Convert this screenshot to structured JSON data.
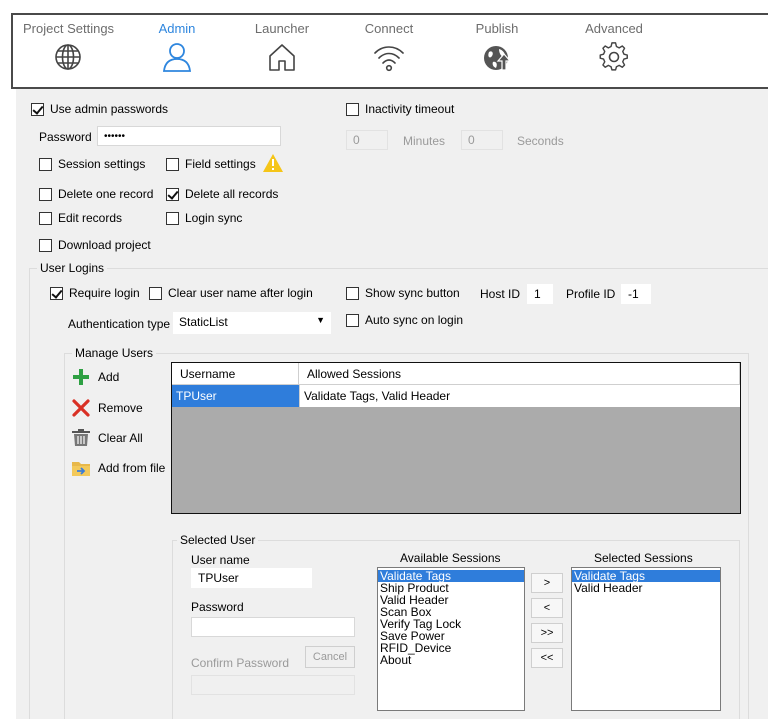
{
  "tabs": [
    {
      "label": "Project Settings",
      "icon": "globe-icon",
      "active": false
    },
    {
      "label": "Admin",
      "icon": "user-icon",
      "active": true
    },
    {
      "label": "Launcher",
      "icon": "home-icon",
      "active": false
    },
    {
      "label": "Connect",
      "icon": "wifi-icon",
      "active": false
    },
    {
      "label": "Publish",
      "icon": "publish-globe-icon",
      "active": false
    },
    {
      "label": "Advanced",
      "icon": "gear-icon",
      "active": false
    }
  ],
  "admin": {
    "use_admin_passwords": "Use admin passwords",
    "password_label": "Password",
    "password_value": "••••••",
    "session_settings": "Session settings",
    "field_settings": "Field settings",
    "delete_one_record": "Delete one record",
    "delete_all_records": "Delete all records",
    "edit_records": "Edit records",
    "login_sync": "Login sync",
    "download_project": "Download project"
  },
  "inactivity": {
    "label": "Inactivity timeout",
    "minutes_value": "0",
    "minutes_label": "Minutes",
    "seconds_value": "0",
    "seconds_label": "Seconds"
  },
  "user_logins": {
    "group_label": "User Logins",
    "require_login": "Require login",
    "clear_user_name": "Clear user name after login",
    "show_sync_button": "Show sync button",
    "host_id_label": "Host ID",
    "host_id_value": "1",
    "profile_id_label": "Profile ID",
    "profile_id_value": "-1",
    "auth_type_label": "Authentication type",
    "auth_type_value": "StaticList",
    "auto_sync": "Auto sync on login"
  },
  "manage_users": {
    "group_label": "Manage Users",
    "add": "Add",
    "remove": "Remove",
    "clear_all": "Clear All",
    "add_from_file": "Add from file",
    "columns": [
      "Username",
      "Allowed Sessions"
    ],
    "rows": [
      {
        "username": "TPUser",
        "sessions": "Validate Tags, Valid Header"
      }
    ]
  },
  "selected_user": {
    "group_label": "Selected User",
    "user_name_label": "User name",
    "user_name_value": "TPUser",
    "password_label": "Password",
    "confirm_password_label": "Confirm Password",
    "cancel_label": "Cancel",
    "available_label": "Available Sessions",
    "available_sessions": [
      "Validate Tags",
      "Ship Product",
      "Valid Header",
      "Scan Box",
      "Verify Tag Lock",
      "Save Power",
      "RFID_Device",
      "About"
    ],
    "selected_label": "Selected Sessions",
    "selected_sessions": [
      "Validate Tags",
      "Valid Header"
    ],
    "move_buttons": [
      ">",
      "<",
      ">>",
      "<<"
    ]
  },
  "colors": {
    "accent": "#2e86de",
    "selection": "#2f7ddb",
    "warning": "#f5c518",
    "add_green": "#2ea043",
    "remove_red": "#d93025"
  }
}
